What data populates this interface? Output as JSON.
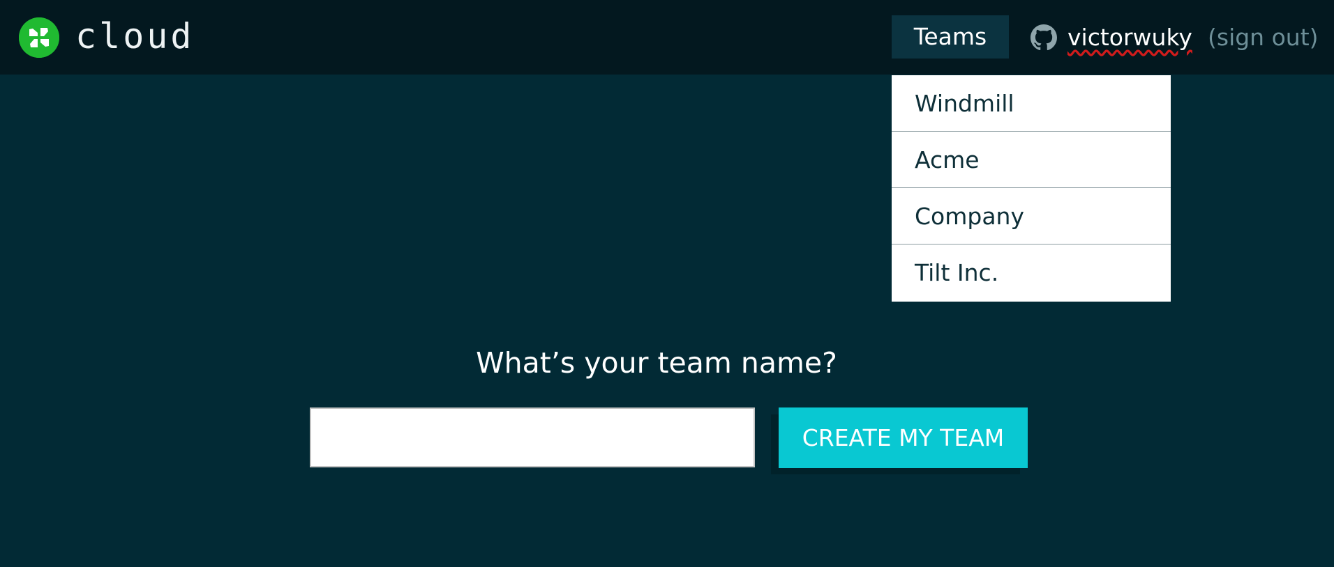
{
  "header": {
    "brand": "cloud",
    "teams_label": "Teams",
    "username": "victorwuky",
    "signout_label": "(sign out)"
  },
  "dropdown": {
    "items": [
      {
        "label": "Windmill"
      },
      {
        "label": "Acme"
      },
      {
        "label": "Company"
      },
      {
        "label": "Tilt Inc."
      }
    ]
  },
  "form": {
    "question": "What’s your team name?",
    "input_value": "",
    "create_button_label": "CREATE MY TEAM"
  },
  "icons": {
    "logo": "windmill-logo-icon",
    "user": "github-icon"
  },
  "colors": {
    "background": "#022a35",
    "header": "#03181f",
    "accent": "#09c8d2",
    "logo_green": "#20ba31"
  }
}
